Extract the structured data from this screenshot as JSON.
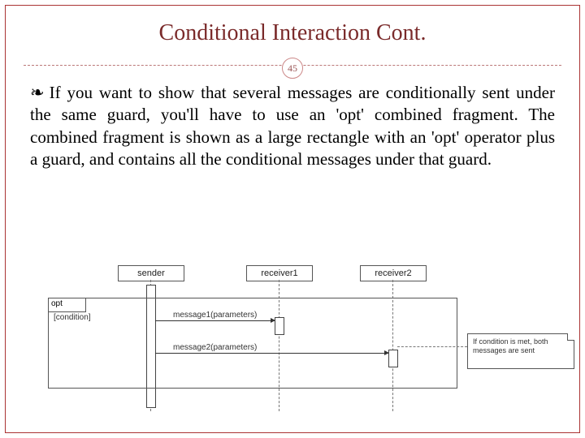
{
  "title": "Conditional Interaction Cont.",
  "page_number": "45",
  "bullet_glyph": "❧",
  "body_text": "If you want to show that several messages are conditionally sent under the same guard, you'll have to use an 'opt' combined fragment. The combined fragment is shown as a large rectangle with an 'opt' operator plus a guard, and contains all the conditional messages under that guard.",
  "diagram": {
    "lifelines": {
      "sender": "sender",
      "receiver1": "receiver1",
      "receiver2": "receiver2"
    },
    "fragment": {
      "operator": "opt",
      "guard": "[condition]"
    },
    "messages": {
      "m1": "message1(parameters)",
      "m2": "message2(parameters)"
    },
    "note": "If condition is met, both messages are sent"
  }
}
